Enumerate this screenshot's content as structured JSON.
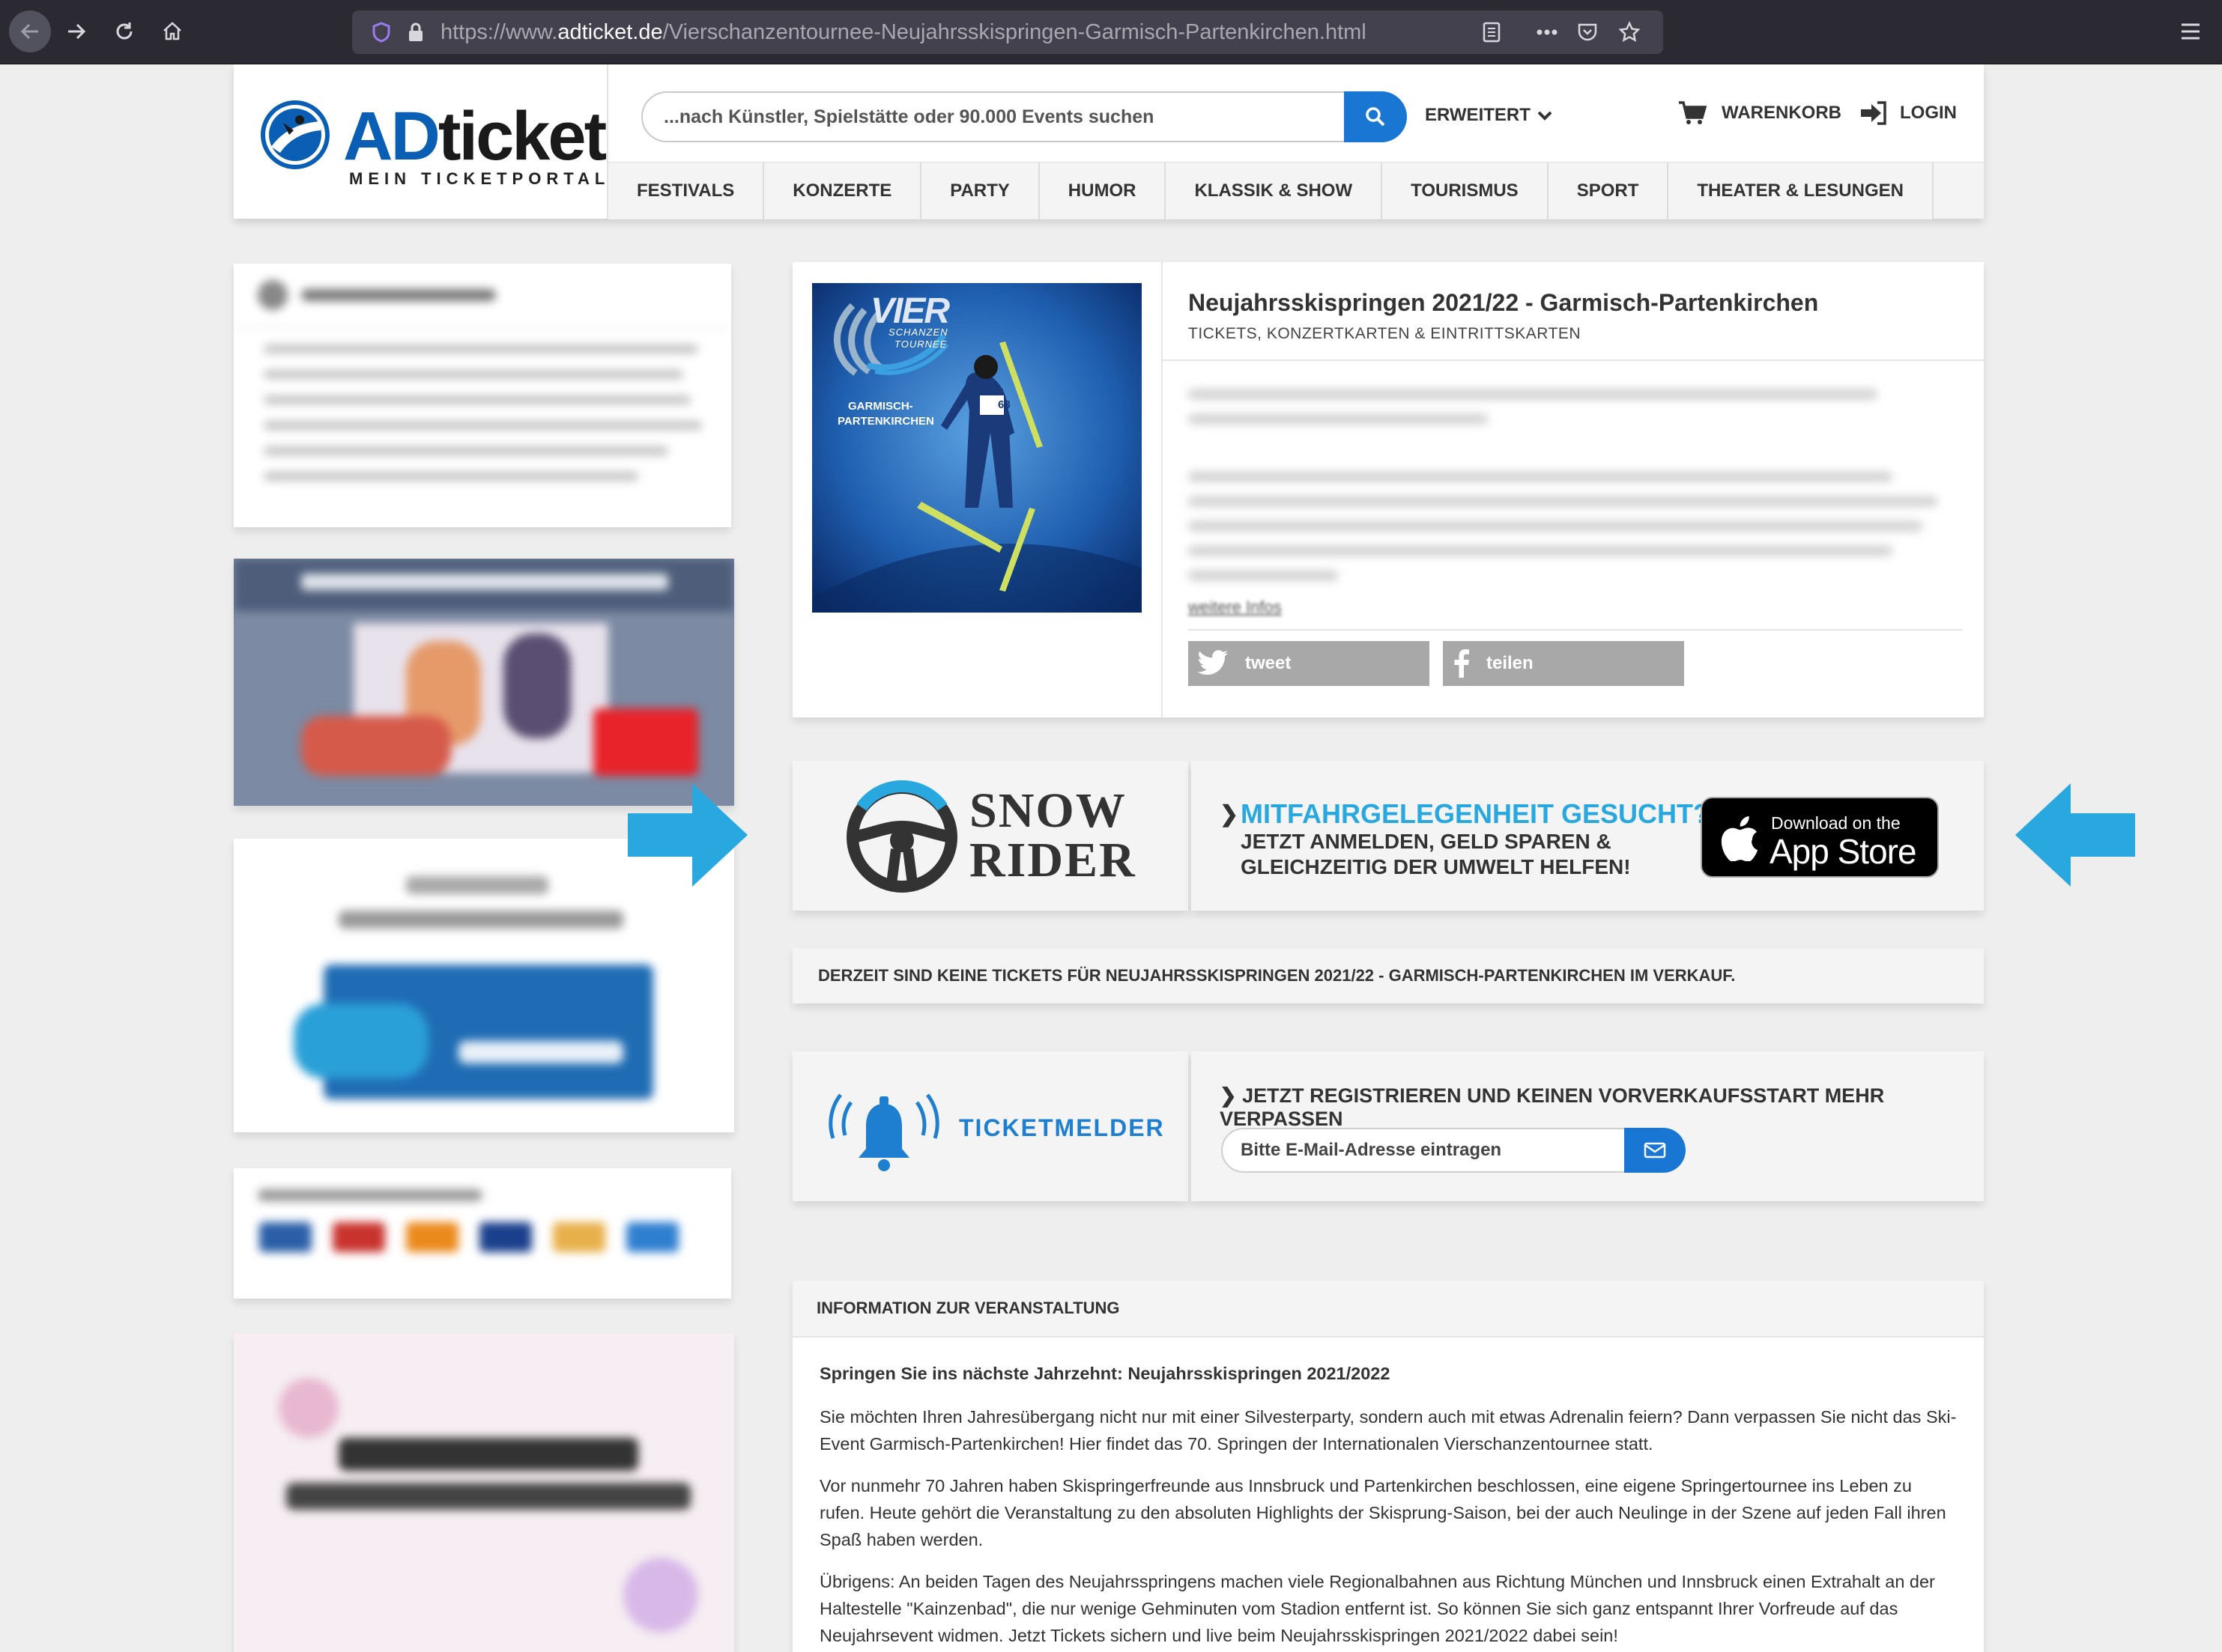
{
  "browser": {
    "url_prefix": "https://www.",
    "url_domain": "adticket.de",
    "url_path": "/Vierschanzentournee-Neujahrsskispringen-Garmisch-Partenkirchen.html"
  },
  "header": {
    "logo_ad": "AD",
    "logo_ticket": "ticket",
    "logo_sub": "MEIN TICKETPORTAL",
    "search_placeholder": "...nach Künstler, Spielstätte oder 90.000 Events suchen",
    "advanced_label": "ERWEITERT",
    "cart_label": "WARENKORB",
    "login_label": "LOGIN",
    "nav": [
      "FESTIVALS",
      "KONZERTE",
      "PARTY",
      "HUMOR",
      "KLASSIK & SHOW",
      "TOURISMUS",
      "SPORT",
      "THEATER & LESUNGEN"
    ]
  },
  "event": {
    "image_text": {
      "vier": "VIER",
      "schanzen": "SCHANZEN",
      "tournee": "TOURNEE",
      "place_1": "GARMISCH-",
      "place_2": "PARTENKIRCHEN",
      "bib": "68"
    },
    "title": "Neujahrsskispringen 2021/22 - Garmisch-Partenkirchen",
    "subtitle": "TICKETS, KONZERTKARTEN & EINTRITTSKARTEN",
    "more_info": "weitere Infos",
    "tweet_label": "tweet",
    "share_label": "teilen"
  },
  "snowrider": {
    "logo_line1": "SNOW",
    "logo_line2": "RIDER",
    "headline": "MITFAHRGELEGENHEIT GESUCHT?",
    "line1": "JETZT ANMELDEN, GELD SPAREN &",
    "line2": "GLEICHZEITIG DER UMWELT HELFEN!",
    "appstore_small": "Download on the",
    "appstore_big": "App Store"
  },
  "no_tickets": "DERZEIT SIND KEINE TICKETS FÜR NEUJAHRSSKISPRINGEN 2021/22 - GARMISCH-PARTENKIRCHEN IM VERKAUF.",
  "ticketmelder": {
    "label": "TICKETMELDER",
    "headline": "JETZT REGISTRIEREN UND KEINEN VORVERKAUFSSTART MEHR VERPASSEN",
    "email_placeholder": "Bitte E-Mail-Adresse eintragen"
  },
  "info": {
    "header": "INFORMATION ZUR VERANSTALTUNG",
    "heading": "Springen Sie ins nächste Jahrzehnt: Neujahrsskispringen 2021/2022",
    "p1": "Sie möchten Ihren Jahresübergang nicht nur mit einer Silvesterparty, sondern auch mit etwas Adrenalin feiern? Dann verpassen Sie nicht das Ski-Event Garmisch-Partenkirchen! Hier findet das 70. Springen der Internationalen Vierschanzentournee statt.",
    "p2": "Vor nunmehr 70 Jahren haben Skispringerfreunde aus Innsbruck und Partenkirchen beschlossen, eine eigene Springertournee ins Leben zu rufen. Heute gehört die Veranstaltung zu den absoluten Highlights der Skisprung-Saison, bei der auch Neulinge in der Szene auf jeden Fall ihren Spaß haben werden.",
    "p3": "Übrigens: An beiden Tagen des Neujahrsspringens machen viele Regionalbahnen aus Richtung München und Innsbruck einen Extrahalt an der Haltestelle \"Kainzenbad\", die nur wenige Gehminuten vom Stadion entfernt ist. So können Sie sich ganz entspannt Ihrer Vorfreude auf das Neujahrsevent widmen. Jetzt Tickets sichern und live beim Neujahrsskispringen 2021/2022 dabei sein!"
  },
  "colors": {
    "brand_blue": "#0a5fb4",
    "accent_blue": "#1976d2",
    "arrow_blue": "#29a8e0"
  }
}
